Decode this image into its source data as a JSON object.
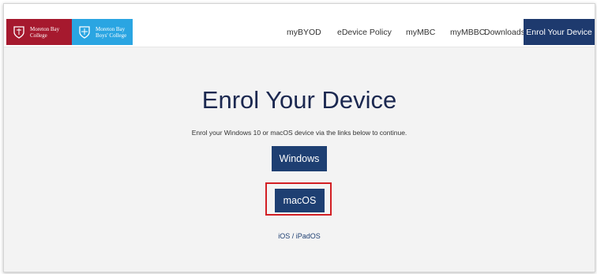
{
  "brand": {
    "mbc_logo_text": "Moreton Bay College",
    "mbbc_logo_text": "Moreton Bay Boys' College",
    "mbc_color": "#a6192e",
    "mbbc_color": "#2aa5e2"
  },
  "nav": {
    "items": [
      {
        "label": "myBYOD"
      },
      {
        "label": "eDevice Policy"
      },
      {
        "label": "myMBC"
      },
      {
        "label": "myMBBC"
      },
      {
        "label": "Downloads"
      }
    ],
    "active_label": "Enrol Your Device",
    "active_color": "#1e3a6e"
  },
  "main": {
    "title": "Enrol Your Device",
    "subtitle": "Enrol your Windows 10 or macOS device via the links below to continue.",
    "windows_button": "Windows",
    "macos_button": "macOS",
    "ios_link": "iOS / iPadOS",
    "button_color": "#1e3f72",
    "highlight_color": "#d21f24"
  }
}
